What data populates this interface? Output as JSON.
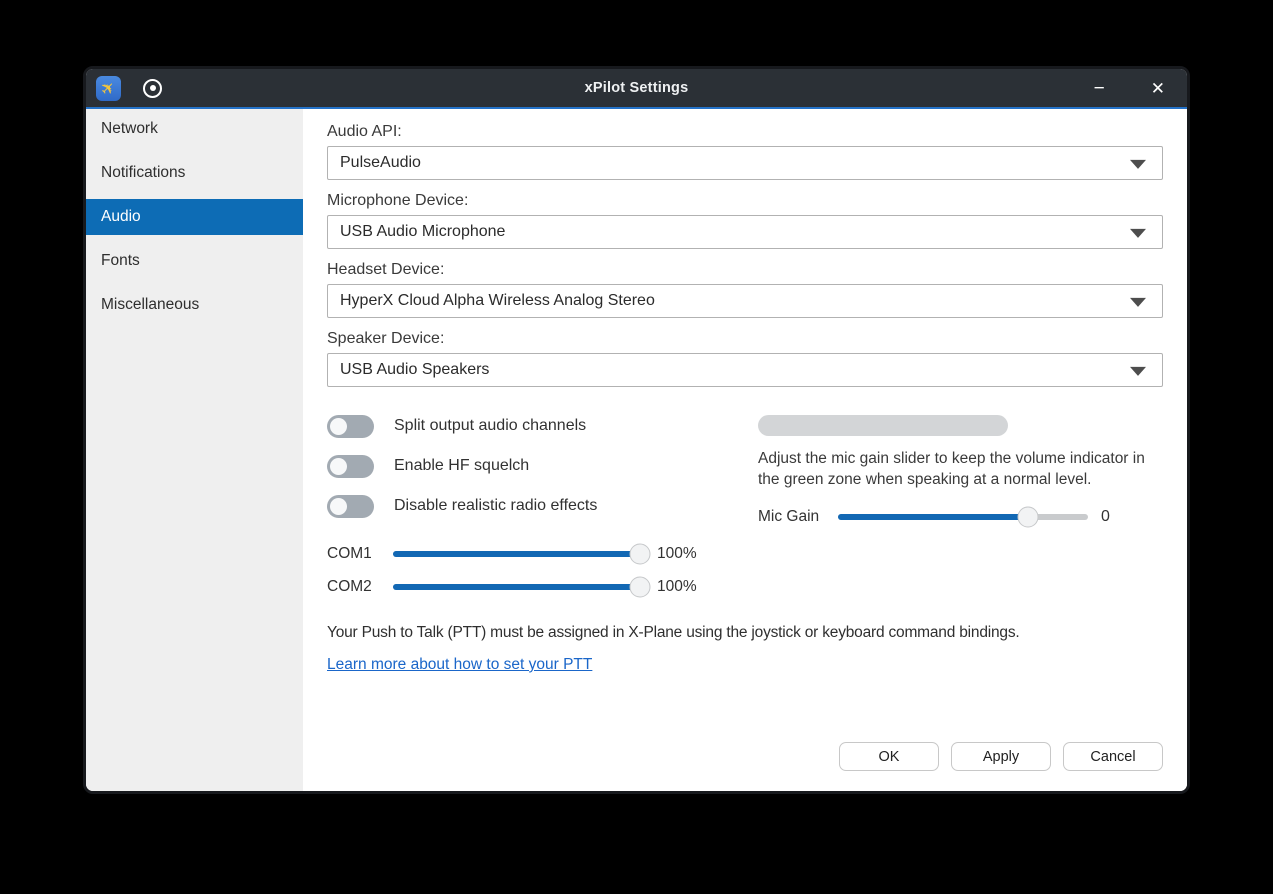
{
  "window": {
    "title": "xPilot Settings",
    "icons": {
      "minimize": "−",
      "close": "✕"
    }
  },
  "sidebar": {
    "items": [
      {
        "label": "Network",
        "selected": false
      },
      {
        "label": "Notifications",
        "selected": false
      },
      {
        "label": "Audio",
        "selected": true
      },
      {
        "label": "Fonts",
        "selected": false
      },
      {
        "label": "Miscellaneous",
        "selected": false
      }
    ]
  },
  "fields": [
    {
      "label": "Audio API:",
      "value": "PulseAudio"
    },
    {
      "label": "Microphone Device:",
      "value": "USB Audio Microphone"
    },
    {
      "label": "Headset Device:",
      "value": "HyperX Cloud Alpha Wireless Analog Stereo"
    },
    {
      "label": "Speaker Device:",
      "value": "USB Audio Speakers"
    }
  ],
  "toggles": [
    {
      "label": "Split output audio channels",
      "on": false
    },
    {
      "label": "Enable HF squelch",
      "on": false
    },
    {
      "label": "Disable realistic radio effects",
      "on": false
    }
  ],
  "volume_sliders": [
    {
      "label": "COM1",
      "value": "100%",
      "percent": 100
    },
    {
      "label": "COM2",
      "value": "100%",
      "percent": 100
    }
  ],
  "mic": {
    "instructions": "Adjust the mic gain slider to keep the volume indicator in the green zone when speaking at a normal level.",
    "gain_label": "Mic Gain",
    "gain_value": "0",
    "gain_percent": 76
  },
  "ptt": {
    "note": "Your Push to Talk (PTT) must be assigned in X-Plane using the joystick or keyboard command bindings.",
    "link": "Learn more about how to set your PTT"
  },
  "buttons": {
    "ok": "OK",
    "apply": "Apply",
    "cancel": "Cancel"
  },
  "colors": {
    "selection_blue": "#0d6cb5",
    "slider_blue": "#1268b4",
    "titlebar": "#2b3036",
    "accent_line": "#2472c8",
    "link_blue": "#1a66c9"
  }
}
